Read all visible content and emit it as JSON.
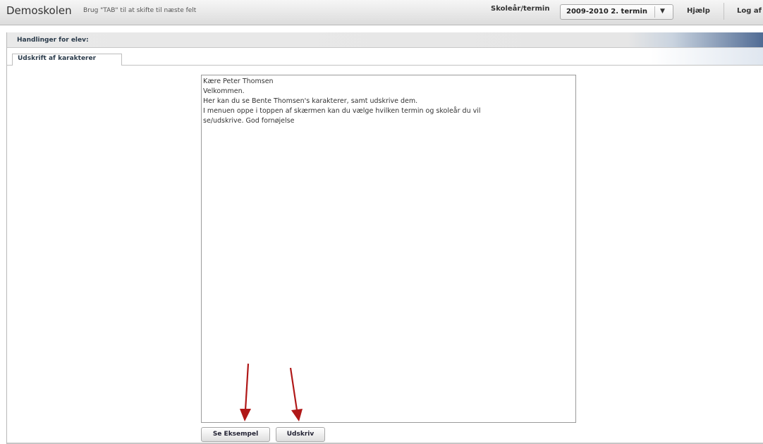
{
  "topbar": {
    "app_name": "Demoskolen",
    "hint": "Brug \"TAB\" til at skifte til næste felt",
    "term_label": "Skoleår/termin",
    "term_value": "2009-2010 2. termin",
    "term_arrow": "▼",
    "help": "Hjælp",
    "logout": "Log af"
  },
  "actions": {
    "title": "Handlinger for elev:"
  },
  "tabs": [
    {
      "label": "Udskrift af karakterer",
      "active": true
    }
  ],
  "message": {
    "lines": [
      "Kære Peter Thomsen",
      "Velkommen.",
      "Her kan du se Bente Thomsen's karakterer, samt udskrive dem.",
      "I menuen oppe i toppen af skærmen kan du vælge hvilken termin og skoleår du vil",
      "se/udskrive. God fornøjelse"
    ]
  },
  "buttons": {
    "preview": "Se Eksempel",
    "print": "Udskriv"
  },
  "colors": {
    "annotation_arrow": "#b01818",
    "header_accent": "#4f6a93"
  }
}
